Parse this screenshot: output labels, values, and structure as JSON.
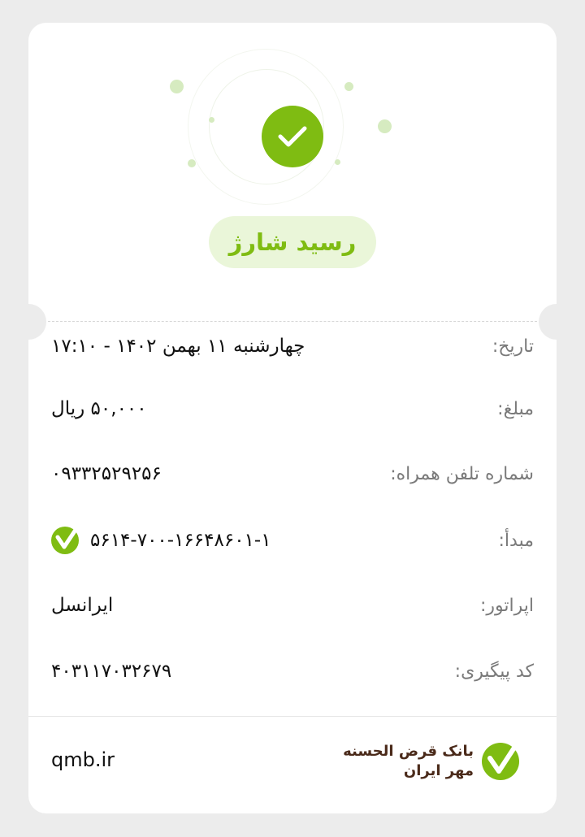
{
  "receipt": {
    "title": "رسید شارژ",
    "rows": [
      {
        "label": "تاریخ:",
        "value": "چهارشنبه ۱۱ بهمن ۱۴۰۲ - ۱۷:۱۰"
      },
      {
        "label": "مبلغ:",
        "value": "۵۰,۰۰۰ ریال"
      },
      {
        "label": "شماره تلفن همراه:",
        "value": "۰۹۳۳۲۵۲۹۲۵۶"
      },
      {
        "label": "مبدأ:",
        "value": "۵۶۱۴-۷۰۰-۱۶۶۴۸۶۰۱-۱"
      },
      {
        "label": "اپراتور:",
        "value": "ایرانسل"
      },
      {
        "label": "کد پیگیری:",
        "value": "۴۰۳۱۱۷۰۳۲۶۷۹"
      }
    ]
  },
  "footer": {
    "site": "qmb.ir",
    "bank_name_line1": "بانک قرض الحسنه",
    "bank_name_line2": "مهر ایران"
  },
  "icons": {
    "success": "check-icon",
    "bank_logo": "bank-logo-icon"
  },
  "colors": {
    "accent": "#7fbc12",
    "accent_light": "#eaf6d9",
    "brand_text": "#4a2a1a"
  }
}
